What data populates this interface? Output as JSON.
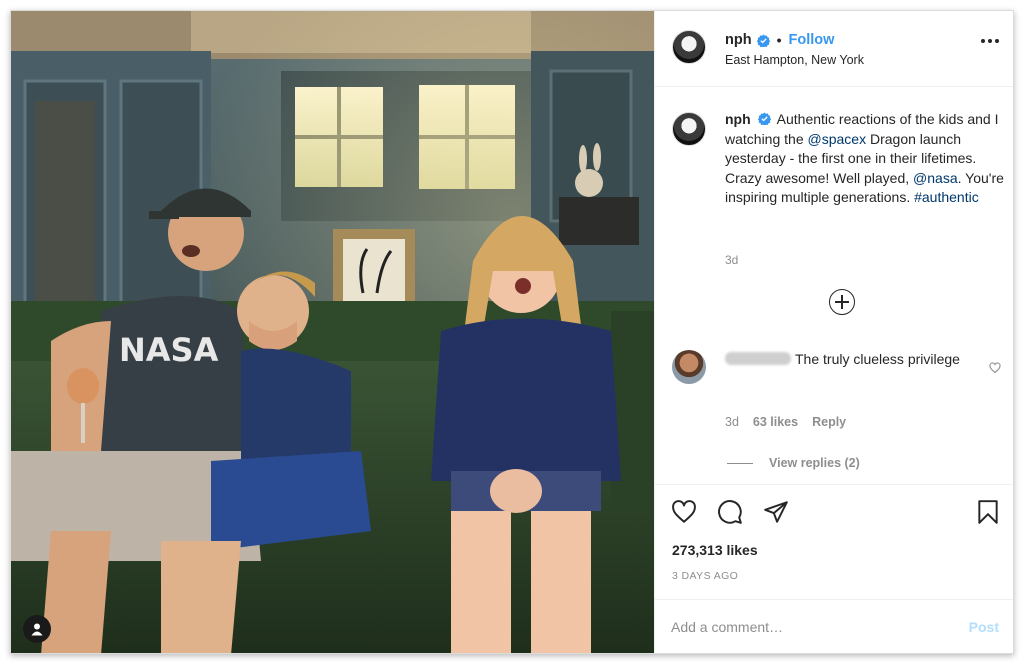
{
  "post": {
    "username": "nph",
    "follow_label": "Follow",
    "separator": "•",
    "location": "East Hampton, New York",
    "photo_alt": "Photo"
  },
  "caption": {
    "username": "nph",
    "segments": [
      {
        "text": "Authentic reactions of the kids and I watching the "
      },
      {
        "text": "@spacex",
        "link": true
      },
      {
        "text": " Dragon launch yesterday - the first one in their lifetimes. Crazy awesome! Well played, "
      },
      {
        "text": "@nasa",
        "link": true
      },
      {
        "text": ". You're inspiring multiple generations. "
      },
      {
        "text": "#authentic",
        "link": true
      }
    ],
    "time": "3d"
  },
  "comment": {
    "text": "The truly clueless privilege",
    "time": "3d",
    "likes": "63 likes",
    "reply_label": "Reply",
    "view_replies": "View replies (2)"
  },
  "stats": {
    "likes": "273,313 likes",
    "time_ago": "3 DAYS AGO"
  },
  "add_comment": {
    "placeholder": "Add a comment…",
    "post_label": "Post"
  },
  "colors": {
    "link_blue": "#3897f0",
    "mention_dark_blue": "#00376b",
    "muted": "#8e8e8e",
    "verified": "#3897f0"
  }
}
